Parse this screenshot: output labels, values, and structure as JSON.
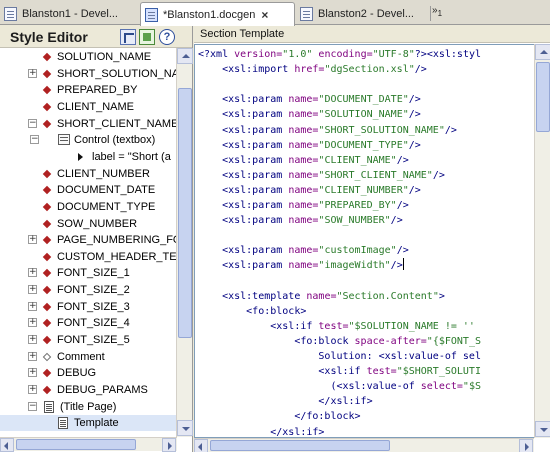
{
  "tabs": [
    {
      "label": "Blanston1 - Devel..."
    },
    {
      "label": "*Blanston1.docgen",
      "close": "×"
    },
    {
      "label": "Blanston2 - Devel..."
    }
  ],
  "tabs_overflow": {
    "glyph": "»",
    "count": "1"
  },
  "style_editor": {
    "title": "Style Editor",
    "help_glyph": "?",
    "tree": [
      {
        "label": "SOLUTION_NAME",
        "icon": "red-diamond"
      },
      {
        "label": "SHORT_SOLUTION_NAI",
        "icon": "red-diamond",
        "expand": "+"
      },
      {
        "label": "PREPARED_BY",
        "icon": "red-diamond"
      },
      {
        "label": "CLIENT_NAME",
        "icon": "red-diamond"
      },
      {
        "label": "SHORT_CLIENT_NAME",
        "icon": "red-diamond",
        "expand": "−"
      },
      {
        "label": "Control (textbox)",
        "icon": "control-icon",
        "expand": "−"
      },
      {
        "label": "label = \"Short (a",
        "icon": "triangle-right"
      },
      {
        "label": "CLIENT_NUMBER",
        "icon": "red-diamond"
      },
      {
        "label": "DOCUMENT_DATE",
        "icon": "red-diamond"
      },
      {
        "label": "DOCUMENT_TYPE",
        "icon": "red-diamond"
      },
      {
        "label": "SOW_NUMBER",
        "icon": "red-diamond"
      },
      {
        "label": "PAGE_NUMBERING_FOR",
        "icon": "red-diamond",
        "expand": "+"
      },
      {
        "label": "CUSTOM_HEADER_TEX",
        "icon": "red-diamond"
      },
      {
        "label": "FONT_SIZE_1",
        "icon": "red-diamond",
        "expand": "+"
      },
      {
        "label": "FONT_SIZE_2",
        "icon": "red-diamond",
        "expand": "+"
      },
      {
        "label": "FONT_SIZE_3",
        "icon": "red-diamond",
        "expand": "+"
      },
      {
        "label": "FONT_SIZE_4",
        "icon": "red-diamond",
        "expand": "+"
      },
      {
        "label": "FONT_SIZE_5",
        "icon": "red-diamond",
        "expand": "+"
      },
      {
        "label": "Comment",
        "icon": "hollow-diamond",
        "expand": "+"
      },
      {
        "label": "DEBUG",
        "icon": "red-diamond",
        "expand": "+"
      },
      {
        "label": "DEBUG_PARAMS",
        "icon": "red-diamond",
        "expand": "+"
      },
      {
        "label": "(Title Page)",
        "icon": "page-icon",
        "expand": "−"
      },
      {
        "label": "Template",
        "icon": "page-icon",
        "selected": true
      }
    ]
  },
  "section_template": {
    "title": "Section Template",
    "lines": [
      "<?xml version=\"1.0\" encoding=\"UTF-8\"?><xsl:styl",
      "    <xsl:import href=\"dgSection.xsl\"/>",
      "",
      "    <xsl:param name=\"DOCUMENT_DATE\"/>",
      "    <xsl:param name=\"SOLUTION_NAME\"/>",
      "    <xsl:param name=\"SHORT_SOLUTION_NAME\"/>",
      "    <xsl:param name=\"DOCUMENT_TYPE\"/>",
      "    <xsl:param name=\"CLIENT_NAME\"/>",
      "    <xsl:param name=\"SHORT_CLIENT_NAME\"/>",
      "    <xsl:param name=\"CLIENT_NUMBER\"/>",
      "    <xsl:param name=\"PREPARED_BY\"/>",
      "    <xsl:param name=\"SOW_NUMBER\"/>",
      "",
      "    <xsl:param name=\"customImage\"/>",
      "    <xsl:param name=\"imageWidth\"/>",
      "",
      "    <xsl:template name=\"Section.Content\">",
      "        <fo:block>",
      "            <xsl:if test=\"$SOLUTION_NAME != ''",
      "                <fo:block space-after=\"{$FONT_S",
      "                    Solution: <xsl:value-of sel",
      "                    <xsl:if test=\"$SHORT_SOLUTI",
      "                      (<xsl:value-of select=\"$S",
      "                    </xsl:if>",
      "                </fo:block>",
      "            </xsl:if>"
    ],
    "caret_line": 14
  }
}
